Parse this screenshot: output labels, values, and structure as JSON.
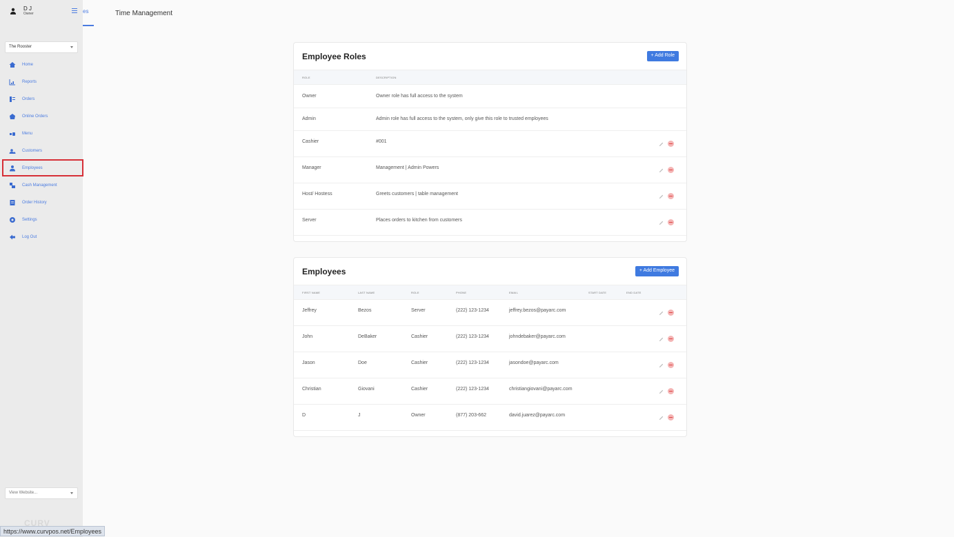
{
  "user": {
    "name": "D J",
    "role": "Owner"
  },
  "store_select": {
    "value": "The Rooster"
  },
  "nav": [
    {
      "label": "Home",
      "icon": "home-icon"
    },
    {
      "label": "Reports",
      "icon": "chart-icon"
    },
    {
      "label": "Orders",
      "icon": "orders-icon"
    },
    {
      "label": "Online Orders",
      "icon": "online-orders-icon"
    },
    {
      "label": "Menu",
      "icon": "menu-icon"
    },
    {
      "label": "Customers",
      "icon": "customers-icon"
    },
    {
      "label": "Employees",
      "icon": "employee-icon",
      "active": true
    },
    {
      "label": "Cash Management",
      "icon": "cash-icon"
    },
    {
      "label": "Order History",
      "icon": "history-icon"
    },
    {
      "label": "Settings",
      "icon": "gear-icon"
    },
    {
      "label": "Log Out",
      "icon": "logout-icon"
    }
  ],
  "website_select": {
    "value": "View Website..."
  },
  "status_url": "https://www.curvpos.net/Employees",
  "tabs": {
    "partial": "es",
    "time_management": "Time Management"
  },
  "roles_card": {
    "title": "Employee Roles",
    "button": "+ Add Role",
    "headers": [
      "ROLE",
      "DESCRIPTION"
    ],
    "rows": [
      {
        "role": "Owner",
        "description": "Owner role has full access to the system"
      },
      {
        "role": "Admin",
        "description": "Admin role has full access to the system, only give this role to trusted employees"
      },
      {
        "role": "Cashier",
        "description": "#001"
      },
      {
        "role": "Manager",
        "description": "Management | Admin Powers"
      },
      {
        "role": "Host/ Hostess",
        "description": "Greets customers | table management"
      },
      {
        "role": "Server",
        "description": "Places orders to kitchen from customers"
      }
    ]
  },
  "employees_card": {
    "title": "Employees",
    "button": "+ Add Employee",
    "headers": [
      "FIRST NAME",
      "LAST NAME",
      "ROLE",
      "PHONE",
      "EMAIL",
      "START DATE",
      "END DATE"
    ],
    "rows": [
      {
        "first": "Jeffrey",
        "last": "Bezos",
        "role": "Server",
        "phone": "(222) 123-1234",
        "email": "jeffrey.bezos@payarc.com"
      },
      {
        "first": "John",
        "last": "DeBaker",
        "role": "Cashier",
        "phone": "(222) 123-1234",
        "email": "johndebaker@payarc.com"
      },
      {
        "first": "Jason",
        "last": "Doe",
        "role": "Cashier",
        "phone": "(222) 123-1234",
        "email": "jasondoe@payarc.com"
      },
      {
        "first": "Christian",
        "last": "Giovani",
        "role": "Cashier",
        "phone": "(222) 123-1234",
        "email": "christiangiovani@payarc.com"
      },
      {
        "first": "D",
        "last": "J",
        "role": "Owner",
        "phone": "(877) 203-662",
        "email": "david.juarez@payarc.com"
      }
    ]
  },
  "colors": {
    "accent": "#4a7be0",
    "button": "#3f7ae0",
    "highlight": "#d62e36",
    "sidebar": "#ebebeb"
  }
}
